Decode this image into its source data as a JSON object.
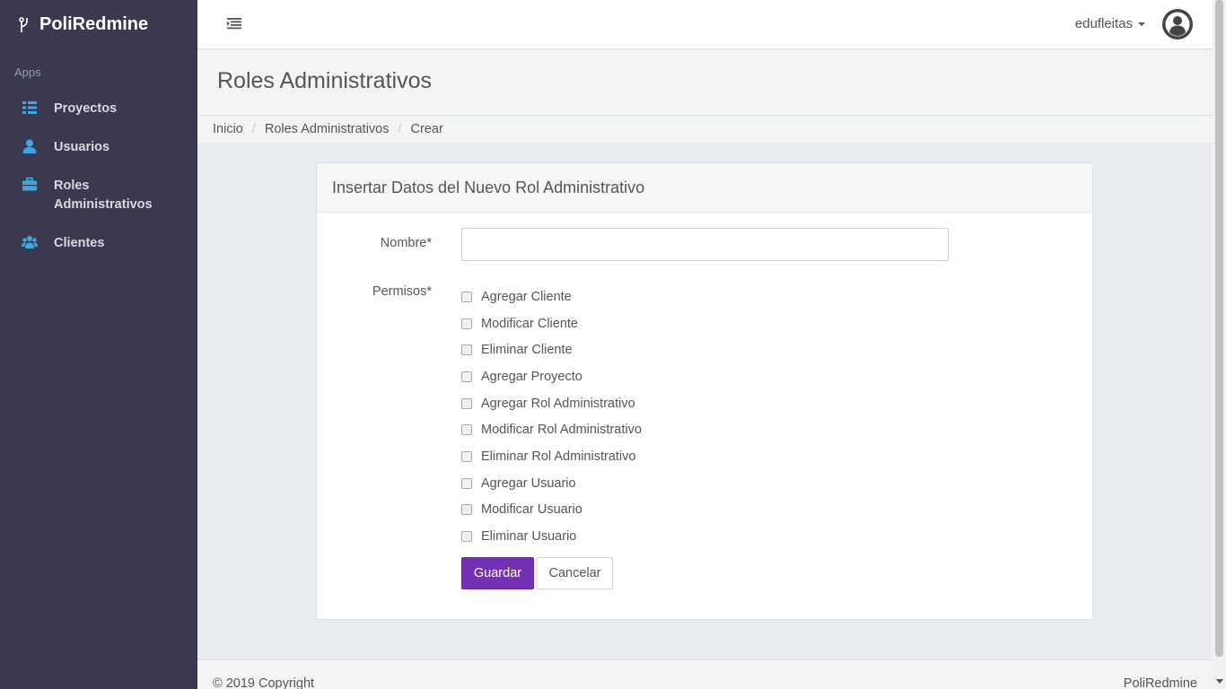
{
  "app": {
    "name": "PoliRedmine"
  },
  "sidebar": {
    "section_label": "Apps",
    "items": [
      {
        "label": "Proyectos",
        "icon": "list-icon"
      },
      {
        "label": "Usuarios",
        "icon": "user-icon"
      },
      {
        "label": "Roles Administrativos",
        "icon": "briefcase-icon"
      },
      {
        "label": "Clientes",
        "icon": "users-icon"
      }
    ]
  },
  "topbar": {
    "username": "edufleitas"
  },
  "page": {
    "title": "Roles Administrativos"
  },
  "breadcrumb": [
    "Inicio",
    "Roles Administrativos",
    "Crear"
  ],
  "form": {
    "heading": "Insertar Datos del Nuevo Rol Administrativo",
    "name_label": "Nombre*",
    "name_value": "",
    "permissions_label": "Permisos*",
    "permissions": [
      "Agregar Cliente",
      "Modificar Cliente",
      "Eliminar Cliente",
      "Agregar Proyecto",
      "Agregar Rol Administrativo",
      "Modificar Rol Administrativo",
      "Eliminar Rol Administrativo",
      "Agregar Usuario",
      "Modificar Usuario",
      "Eliminar Usuario"
    ],
    "save_label": "Guardar",
    "cancel_label": "Cancelar"
  },
  "footer": {
    "copyright": "© 2019 Copyright",
    "brand": "PoliRedmine"
  },
  "colors": {
    "sidebar_bg": "#3a3950",
    "accent": "#7431b3",
    "icon": "#3ea6e0"
  }
}
